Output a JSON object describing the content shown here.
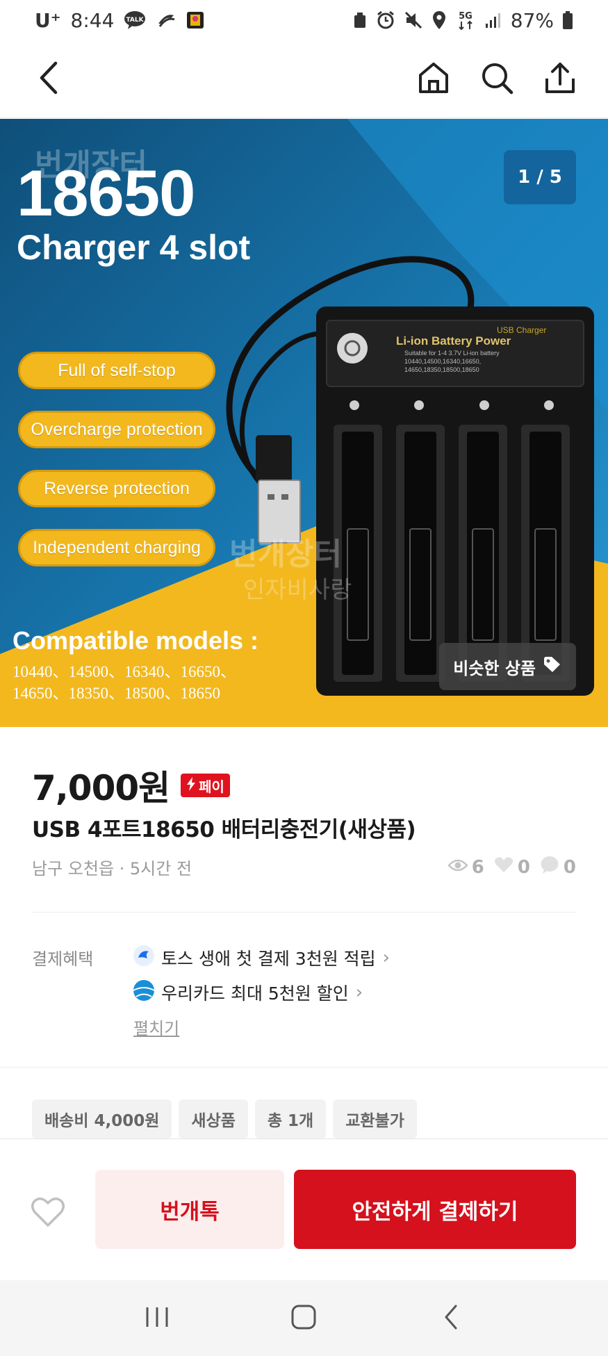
{
  "status_bar": {
    "carrier": "U⁺",
    "time": "8:44",
    "talk_badge": "TALK",
    "network": "5G",
    "battery": "87%"
  },
  "nav": {
    "back_icon": "back-arrow-icon",
    "home_icon": "home-icon",
    "search_icon": "search-icon",
    "share_icon": "share-icon"
  },
  "hero": {
    "model": "18650",
    "subtitle": "Charger 4 slot",
    "watermark_brand": "번개장터",
    "watermark_seller": "인자비사랑",
    "features": [
      "Full of self-stop",
      "Overcharge protection",
      "Reverse protection",
      "Independent charging"
    ],
    "compat_title": "Compatible models :",
    "compat_line1": "10440、14500、16340、16650、",
    "compat_line2": "14650、18350、18500、18650",
    "charger_label1": "USB Charger",
    "charger_label2": "Li-ion Battery  Power",
    "charger_label3": "Suitable for 1-4 3.7V Li-ion battery",
    "charger_label4": "10440,14500,16340,16650,",
    "charger_label5": "14650,18350,18500,18650",
    "page_counter": "1 / 5",
    "similar_button": "비슷한 상품"
  },
  "product": {
    "price": "7,000원",
    "pay_badge": "페이",
    "title": "USB 4포트18650 배터리충전기(새상품)",
    "location_time": "남구 오천읍 · 5시간 전",
    "views": "6",
    "likes": "0",
    "chats": "0"
  },
  "benefits": {
    "label": "결제혜택",
    "items": [
      "토스 생애 첫 결제 3천원 적립",
      "우리카드 최대 5천원 할인"
    ],
    "expand": "펼치기"
  },
  "tags": [
    "배송비 4,000원",
    "새상품",
    "총 1개",
    "교환불가"
  ],
  "actions": {
    "chat": "번개톡",
    "pay": "안전하게 결제하기"
  },
  "colors": {
    "brand_red": "#d4111d",
    "hero_blue": "#1e7db5",
    "hero_yellow": "#f2b81e"
  }
}
